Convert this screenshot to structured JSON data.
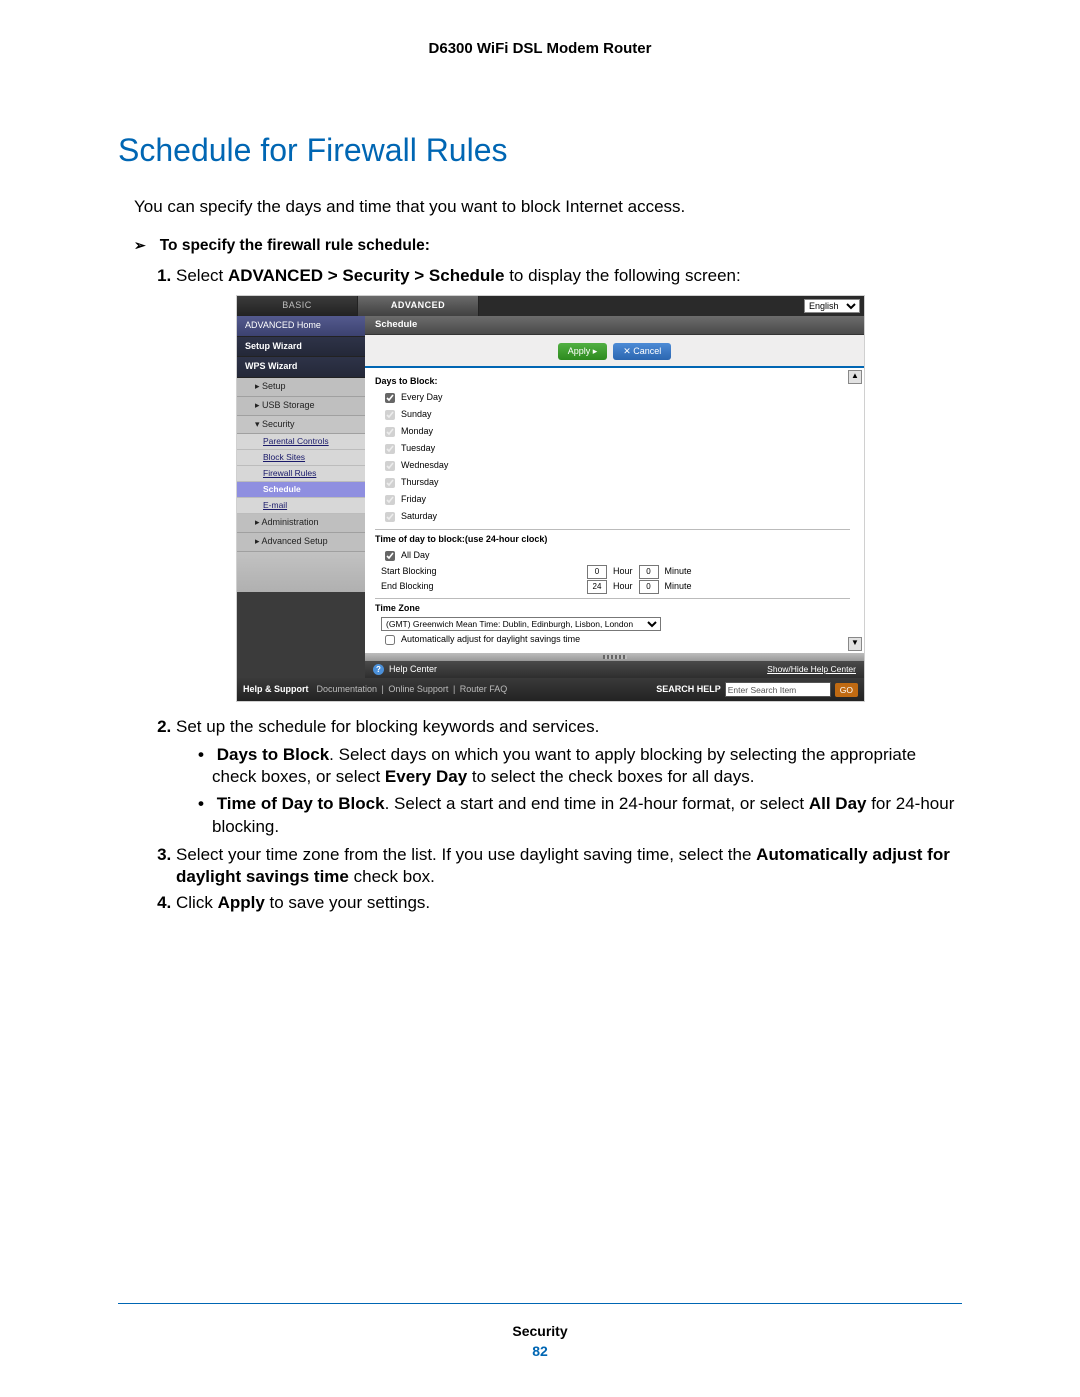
{
  "header": {
    "device_title": "D6300 WiFi DSL Modem Router"
  },
  "section": {
    "heading": "Schedule for Firewall Rules",
    "intro": "You can specify the days and time that you want to block Internet access.",
    "procedure_heading": "To specify the firewall rule schedule:"
  },
  "screenshot": {
    "tabs": {
      "basic": "BASIC",
      "advanced": "ADVANCED"
    },
    "language": "English",
    "sidebar": {
      "advanced_home": "ADVANCED Home",
      "setup_wizard": "Setup Wizard",
      "wps_wizard": "WPS Wizard",
      "setup": "Setup",
      "usb_storage": "USB Storage",
      "security": "Security",
      "security_children": {
        "parental_controls": "Parental Controls",
        "block_sites": "Block Sites",
        "firewall_rules": "Firewall Rules",
        "schedule": "Schedule",
        "email": "E-mail"
      },
      "administration": "Administration",
      "advanced_setup": "Advanced Setup"
    },
    "panel": {
      "title": "Schedule",
      "apply": "Apply ▸",
      "cancel": "✕ Cancel",
      "days_heading": "Days to Block:",
      "days": {
        "every_day": "Every Day",
        "sunday": "Sunday",
        "monday": "Monday",
        "tuesday": "Tuesday",
        "wednesday": "Wednesday",
        "thursday": "Thursday",
        "friday": "Friday",
        "saturday": "Saturday"
      },
      "time_heading": "Time of day to block:(use 24-hour clock)",
      "all_day": "All Day",
      "start_blocking": "Start Blocking",
      "end_blocking": "End Blocking",
      "hour": "Hour",
      "minute": "Minute",
      "start_hour_val": "0",
      "start_min_val": "0",
      "end_hour_val": "24",
      "end_min_val": "0",
      "tz_heading": "Time Zone",
      "tz_value": "(GMT) Greenwich Mean Time: Dublin, Edinburgh, Lisbon, London",
      "dst": "Automatically adjust for daylight savings time",
      "help_center": "Help Center",
      "show_hide_help": "Show/Hide Help Center"
    },
    "footer": {
      "help_support": "Help & Support",
      "documentation": "Documentation",
      "online_support": "Online Support",
      "router_faq": "Router FAQ",
      "search_label": "SEARCH HELP",
      "search_placeholder": "Enter Search Item",
      "go": "GO"
    }
  },
  "steps": {
    "s1_a": "Select ",
    "s1_b": "ADVANCED > Security > Schedule",
    "s1_c": " to display the following screen:",
    "s2": "Set up the schedule for blocking keywords and services.",
    "s2a_b1": "Days to Block",
    "s2a_t": ". Select days on which you want to apply blocking by selecting the appropriate check boxes, or select ",
    "s2a_b2": "Every Day",
    "s2a_t2": " to select the check boxes for all days.",
    "s2b_b1": "Time of Day to Block",
    "s2b_t1": ". Select a start and end time in 24-hour format, or select ",
    "s2b_b2": "All Day",
    "s2b_t2": " for 24-hour blocking.",
    "s3_t1": "Select your time zone from the list. If you use daylight saving time, select the ",
    "s3_b": "Automatically adjust for daylight savings time",
    "s3_t2": " check box.",
    "s4_t1": "Click ",
    "s4_b": "Apply",
    "s4_t2": " to save your settings."
  },
  "footer": {
    "section": "Security",
    "page_number": "82"
  }
}
